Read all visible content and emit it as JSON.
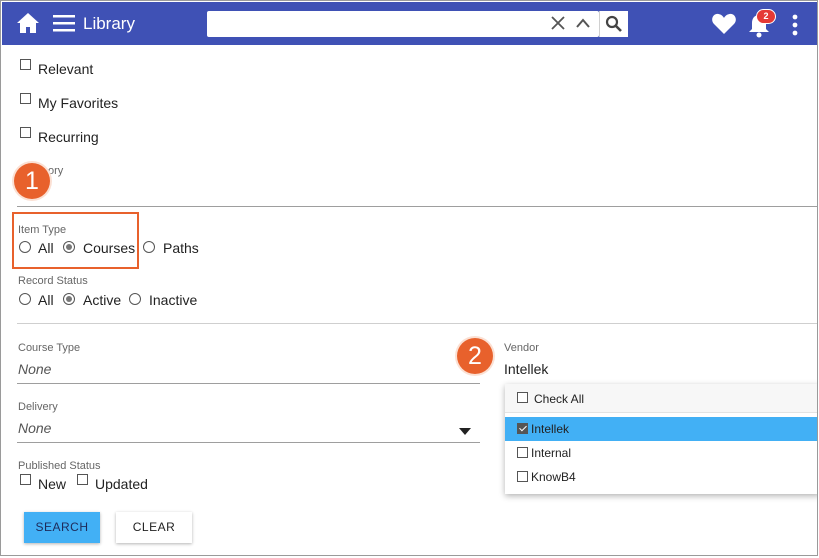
{
  "header": {
    "title": "Library",
    "search_value": "",
    "notification_count": "2",
    "bg_color": "#3f51b5"
  },
  "filters": {
    "checkboxes": [
      {
        "label": "Relevant",
        "checked": false
      },
      {
        "label": "My Favorites",
        "checked": false
      },
      {
        "label": "Recurring",
        "checked": false
      }
    ],
    "category_label_partial": "ory",
    "item_type": {
      "label": "Item Type",
      "options": [
        "All",
        "Courses",
        "Paths"
      ],
      "selected": "Courses"
    },
    "record_status": {
      "label": "Record Status",
      "options": [
        "All",
        "Active",
        "Inactive"
      ],
      "selected": "Active"
    },
    "course_type": {
      "label": "Course Type",
      "value": "None"
    },
    "vendor": {
      "label": "Vendor",
      "value": "Intellek"
    },
    "delivery": {
      "label": "Delivery",
      "value": "None"
    },
    "published_status": {
      "label": "Published Status",
      "options": [
        {
          "label": "New",
          "checked": false
        },
        {
          "label": "Updated",
          "checked": false
        }
      ]
    }
  },
  "vendor_dropdown": {
    "check_all_label": "Check All",
    "items": [
      {
        "label": "Intellek",
        "checked": true,
        "selected": true
      },
      {
        "label": "Internal",
        "checked": false,
        "selected": false
      },
      {
        "label": "KnowB4",
        "checked": false,
        "selected": false
      }
    ],
    "selected_color": "#42b0f5"
  },
  "callouts": [
    "1",
    "2"
  ],
  "callout_color": "#e8612c",
  "buttons": {
    "search": "SEARCH",
    "clear": "CLEAR"
  }
}
